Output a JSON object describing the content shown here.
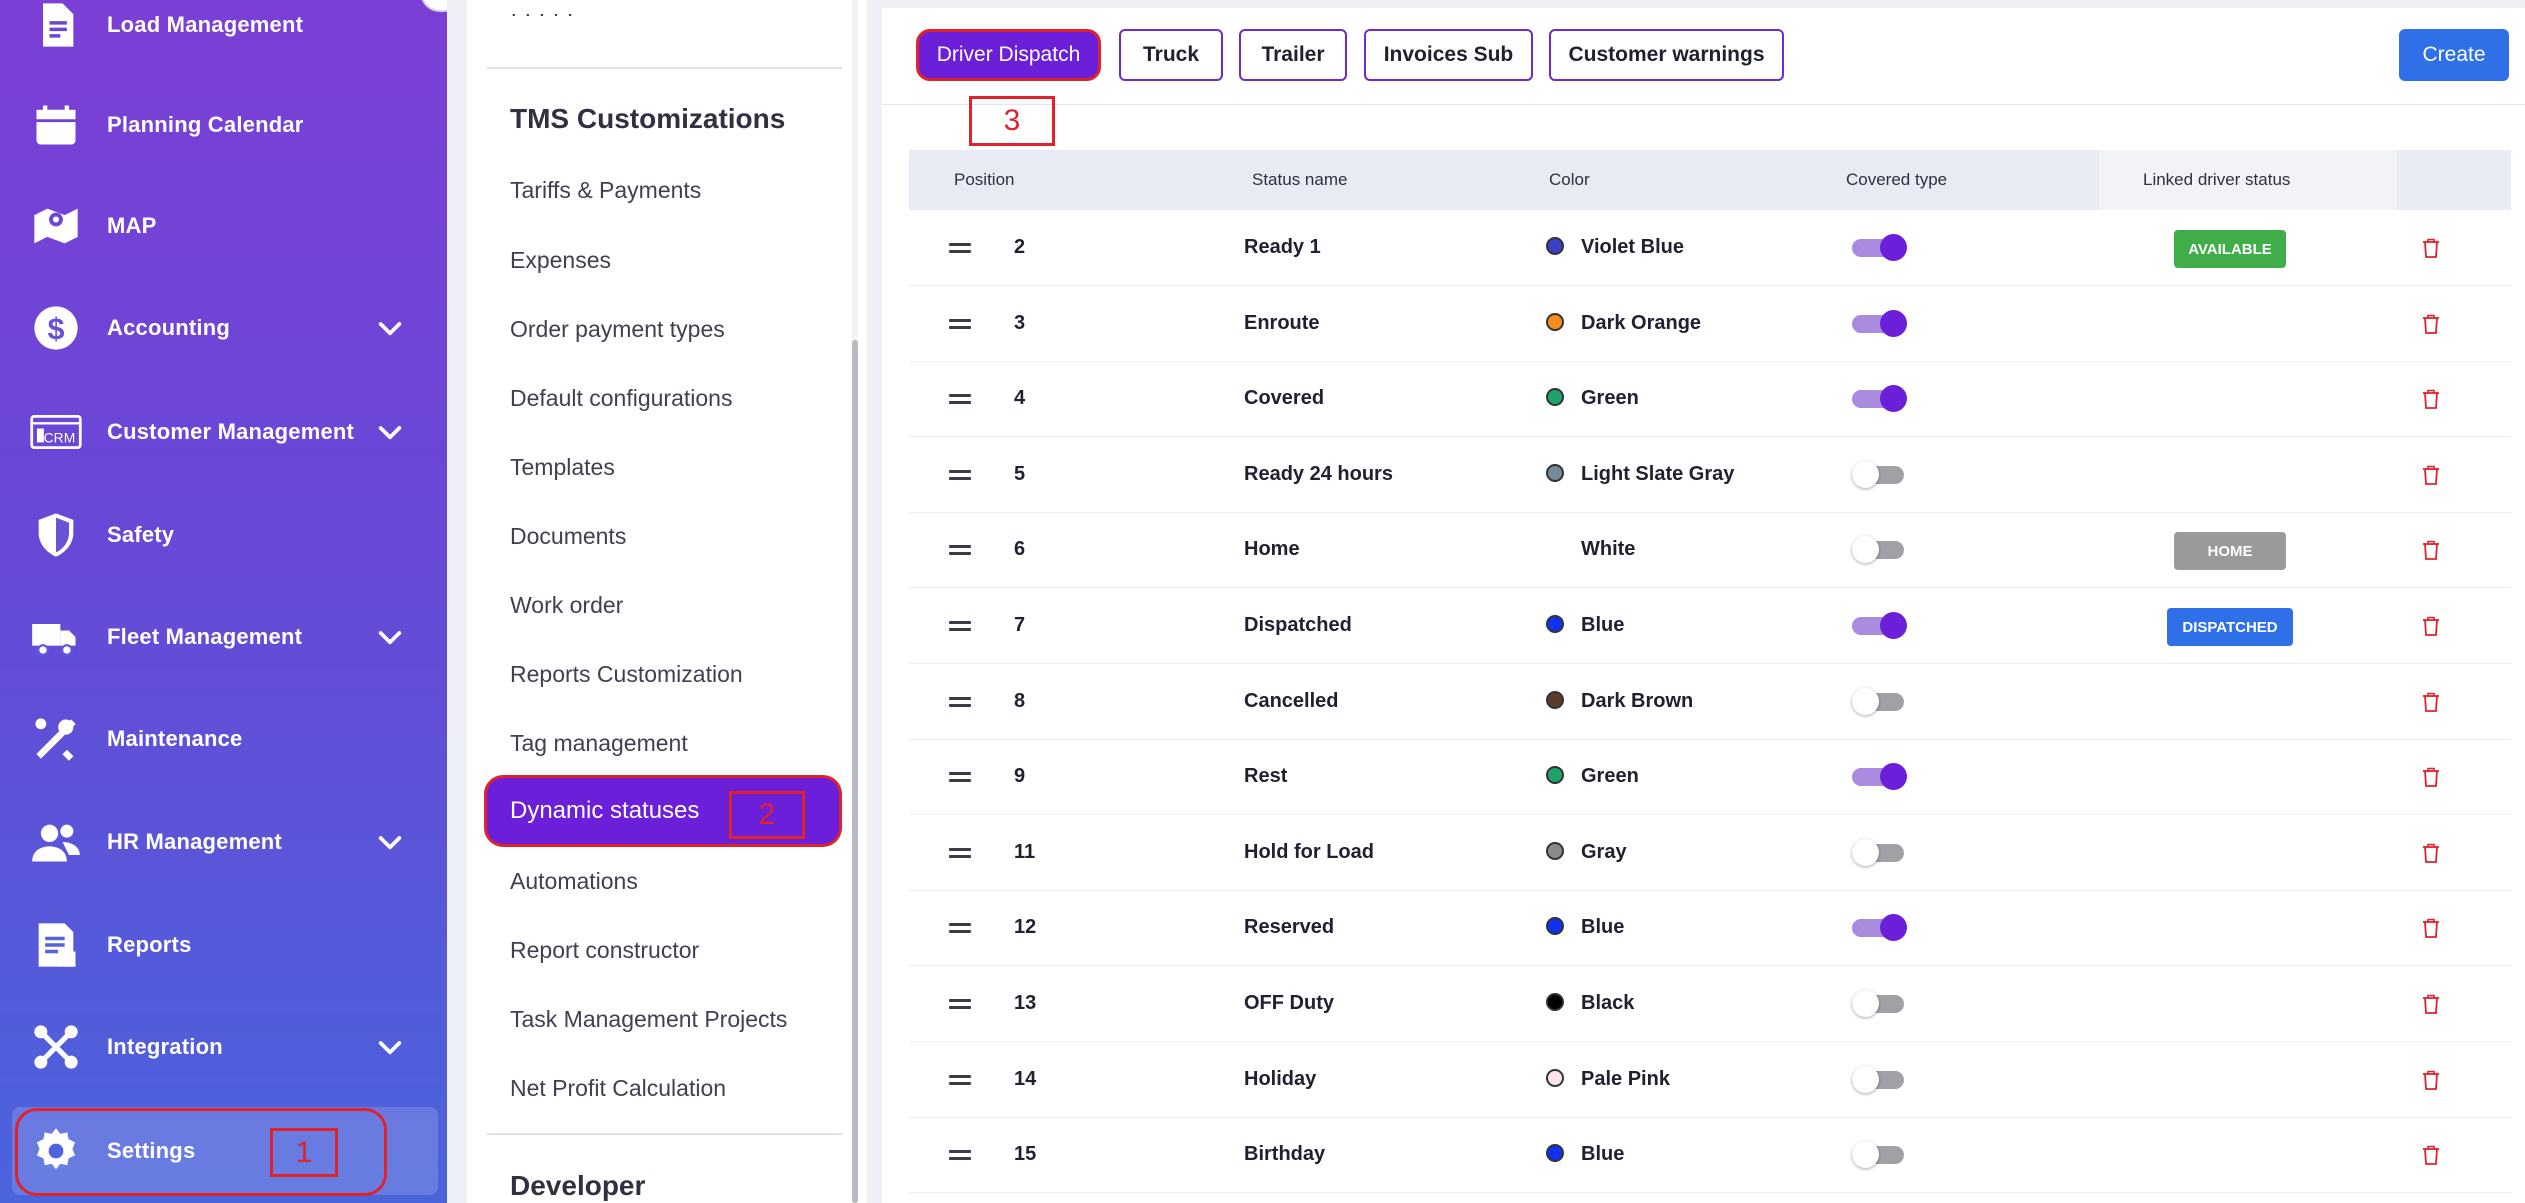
{
  "sidebar": {
    "items": [
      {
        "label": "Load Management",
        "icon": "document-icon",
        "chevron": false
      },
      {
        "label": "Planning Calendar",
        "icon": "calendar-icon",
        "chevron": false
      },
      {
        "label": "MAP",
        "icon": "map-icon",
        "chevron": false
      },
      {
        "label": "Accounting",
        "icon": "dollar-icon",
        "chevron": true
      },
      {
        "label": "Customer Management",
        "icon": "crm-icon",
        "chevron": true
      },
      {
        "label": "Safety",
        "icon": "shield-icon",
        "chevron": false
      },
      {
        "label": "Fleet Management",
        "icon": "truck-icon",
        "chevron": true
      },
      {
        "label": "Maintenance",
        "icon": "wrench-icon",
        "chevron": false
      },
      {
        "label": "HR Management",
        "icon": "people-icon",
        "chevron": true
      },
      {
        "label": "Reports",
        "icon": "report-icon",
        "chevron": false
      },
      {
        "label": "Integration",
        "icon": "integration-icon",
        "chevron": true
      },
      {
        "label": "Settings",
        "icon": "gear-icon",
        "chevron": false,
        "active": true
      }
    ],
    "crm_icon_text": "CRM"
  },
  "annotations": {
    "step1": "1",
    "step2": "2",
    "step3": "3"
  },
  "settings_menu": {
    "heading": "TMS Customizations",
    "items": [
      "Tariffs & Payments",
      "Expenses",
      "Order payment types",
      "Default configurations",
      "Templates",
      "Documents",
      "Work order",
      "Reports Customization",
      "Tag management",
      "Dynamic statuses",
      "Automations",
      "Report constructor",
      "Task Management Projects",
      "Net Profit Calculation"
    ],
    "active_item": "Dynamic statuses",
    "next_heading": "Developer"
  },
  "tabs": [
    "Driver Dispatch",
    "Truck",
    "Trailer",
    "Invoices Sub",
    "Customer warnings"
  ],
  "active_tab": "Driver Dispatch",
  "create_label": "Create",
  "table": {
    "columns": [
      "Position",
      "Status name",
      "Color",
      "Covered type",
      "Linked driver status"
    ],
    "rows": [
      {
        "position": "2",
        "name": "Ready 1",
        "color": "Violet Blue",
        "hex": "#3b3fc4",
        "covered": true,
        "linked": "AVAILABLE",
        "linked_color": "#3fae49"
      },
      {
        "position": "3",
        "name": "Enroute",
        "color": "Dark Orange",
        "hex": "#f58d1e",
        "covered": true,
        "linked": "",
        "linked_color": ""
      },
      {
        "position": "4",
        "name": "Covered",
        "color": "Green",
        "hex": "#1fa36b",
        "covered": true,
        "linked": "",
        "linked_color": ""
      },
      {
        "position": "5",
        "name": "Ready 24 hours",
        "color": "Light Slate Gray",
        "hex": "#778899",
        "covered": false,
        "linked": "",
        "linked_color": ""
      },
      {
        "position": "6",
        "name": "Home",
        "color": "White",
        "hex": "#ffffff",
        "covered": false,
        "linked": "HOME",
        "linked_color": "#9a9a9a"
      },
      {
        "position": "7",
        "name": "Dispatched",
        "color": "Blue",
        "hex": "#1230f0",
        "covered": true,
        "linked": "DISPATCHED",
        "linked_color": "#2f6fe8"
      },
      {
        "position": "8",
        "name": "Cancelled",
        "color": "Dark Brown",
        "hex": "#5c3b2a",
        "covered": false,
        "linked": "",
        "linked_color": ""
      },
      {
        "position": "9",
        "name": "Rest",
        "color": "Green",
        "hex": "#1fa36b",
        "covered": true,
        "linked": "",
        "linked_color": ""
      },
      {
        "position": "11",
        "name": "Hold for Load",
        "color": "Gray",
        "hex": "#8a8a8a",
        "covered": false,
        "linked": "",
        "linked_color": ""
      },
      {
        "position": "12",
        "name": "Reserved",
        "color": "Blue",
        "hex": "#1230f0",
        "covered": true,
        "linked": "",
        "linked_color": ""
      },
      {
        "position": "13",
        "name": "OFF Duty",
        "color": "Black",
        "hex": "#000000",
        "covered": false,
        "linked": "",
        "linked_color": ""
      },
      {
        "position": "14",
        "name": "Holiday",
        "color": "Pale Pink",
        "hex": "#fde4e8",
        "covered": false,
        "linked": "",
        "linked_color": ""
      },
      {
        "position": "15",
        "name": "Birthday",
        "color": "Blue",
        "hex": "#1230f0",
        "covered": false,
        "linked": "",
        "linked_color": ""
      }
    ]
  },
  "colors": {
    "brand_purple": "#6c1fd8",
    "create_blue": "#2f6fe8",
    "annotation_red": "#e0222c",
    "delete_red": "#e0222c"
  }
}
